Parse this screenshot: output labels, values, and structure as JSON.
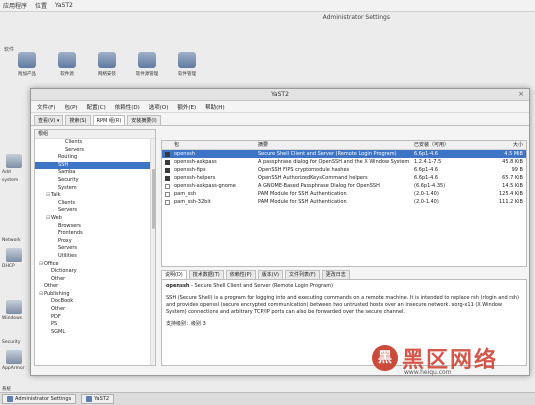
{
  "top_panel": {
    "items": [
      "应用程序",
      "位置",
      "YaST2"
    ]
  },
  "bg_window": {
    "title": "Administrator Settings",
    "section_software": "软件",
    "icons": [
      {
        "label": "附加产品"
      },
      {
        "label": "软件源"
      },
      {
        "label": "网络安装"
      },
      {
        "label": "软件源管理"
      },
      {
        "label": "软件管理"
      }
    ],
    "left_items": [
      "Add",
      "system",
      "Network",
      "DHCP",
      "Windows",
      "AppArmor",
      "Security",
      "系统"
    ]
  },
  "yast": {
    "title": "YaST2",
    "menu": [
      "文件(F)",
      "包(P)",
      "配置(C)",
      "依赖性(D)",
      "选项(O)",
      "额外(E)",
      "帮助(H)"
    ],
    "tabs": [
      "查看(V) ▾",
      "搜索(S)",
      "RPM 组(R)",
      "安装摘要(I)"
    ],
    "active_tab_index": 2,
    "tree_header": "根组",
    "tree": [
      {
        "label": "Clients",
        "indent": 3
      },
      {
        "label": "Servers",
        "indent": 3
      },
      {
        "label": "Routing",
        "indent": 2
      },
      {
        "label": "SSH",
        "indent": 2,
        "selected": true
      },
      {
        "label": "Samba",
        "indent": 2
      },
      {
        "label": "Security",
        "indent": 2
      },
      {
        "label": "System",
        "indent": 2
      },
      {
        "label": "Talk",
        "indent": 1,
        "expandable": true
      },
      {
        "label": "Clients",
        "indent": 2
      },
      {
        "label": "Servers",
        "indent": 2
      },
      {
        "label": "Web",
        "indent": 1,
        "expandable": true
      },
      {
        "label": "Browsers",
        "indent": 2
      },
      {
        "label": "Frontends",
        "indent": 2
      },
      {
        "label": "Proxy",
        "indent": 2
      },
      {
        "label": "Servers",
        "indent": 2
      },
      {
        "label": "Utilities",
        "indent": 2
      },
      {
        "label": "Office",
        "indent": 0,
        "expandable": true
      },
      {
        "label": "Dictionary",
        "indent": 1
      },
      {
        "label": "Other",
        "indent": 1
      },
      {
        "label": "Other",
        "indent": 0
      },
      {
        "label": "Publishing",
        "indent": 0,
        "expandable": true
      },
      {
        "label": "DocBook",
        "indent": 1
      },
      {
        "label": "Other",
        "indent": 1
      },
      {
        "label": "PDF",
        "indent": 1
      },
      {
        "label": "PS",
        "indent": 1
      },
      {
        "label": "SGML",
        "indent": 1
      }
    ],
    "columns": [
      "包",
      "摘要",
      "已安装（可用）",
      "大小"
    ],
    "packages": [
      {
        "name": "openssh",
        "summary": "Secure Shell Client and Server (Remote Login Program)",
        "version": "6.6p1-4.6",
        "size": "4.5 MiB",
        "checked": true,
        "selected": true
      },
      {
        "name": "openssh-askpass",
        "summary": "A passphrase dialog for OpenSSH and the X Window System",
        "version": "1.2.4.1-7.5",
        "size": "45.8 KiB",
        "checked": true,
        "selected": false
      },
      {
        "name": "openssh-fips",
        "summary": "OpenSSH FIPS cryptomodule hashes",
        "version": "6.6p1-4.6",
        "size": "99 B",
        "checked": true,
        "selected": false
      },
      {
        "name": "openssh-helpers",
        "summary": "OpenSSH AuthorizedKeysCommand helpers",
        "version": "6.6p1-4.6",
        "size": "65.7 KiB",
        "checked": true,
        "selected": false
      },
      {
        "name": "openssh-askpass-gnome",
        "summary": "A GNOME-Based Passphrase Dialog for OpenSSH",
        "version": "(6.6p1-4.35)",
        "size": "14.5 KiB",
        "checked": false,
        "selected": false
      },
      {
        "name": "pam_ssh",
        "summary": "PAM Module for SSH Authentication",
        "version": "(2.0-1.40)",
        "size": "125.4 KiB",
        "checked": false,
        "selected": false
      },
      {
        "name": "pam_ssh-32bit",
        "summary": "PAM Module for SSH Authentication",
        "version": "(2.0-1.40)",
        "size": "111.2 KiB",
        "checked": false,
        "selected": false
      }
    ],
    "detail_tabs": [
      "说明(D)",
      "技术数据(T)",
      "依赖性(P)",
      "版本(V)",
      "文件列表(F)",
      "更改日志"
    ],
    "detail": {
      "title_name": "openssh",
      "title_rest": " - Secure Shell Client and Server (Remote Login Program)",
      "body": "SSH (Secure Shell) is a program for logging into and executing commands on a remote machine. It is intended to replace rsh (rlogin and rsh) and provides openssl (secure encrypted communication) between two untrusted hosts over an insecure network. xorg-x11 (X Window System) connections and arbitrary TCP/IP ports can also be forwarded over the secure channel.",
      "support": "支持级别：级别 3"
    }
  },
  "taskbar": {
    "items": [
      "Administrator Settings",
      "YaST2"
    ]
  },
  "watermark": {
    "logo": "黑",
    "text": "黑区网络",
    "url": "www.heiqu.com"
  }
}
